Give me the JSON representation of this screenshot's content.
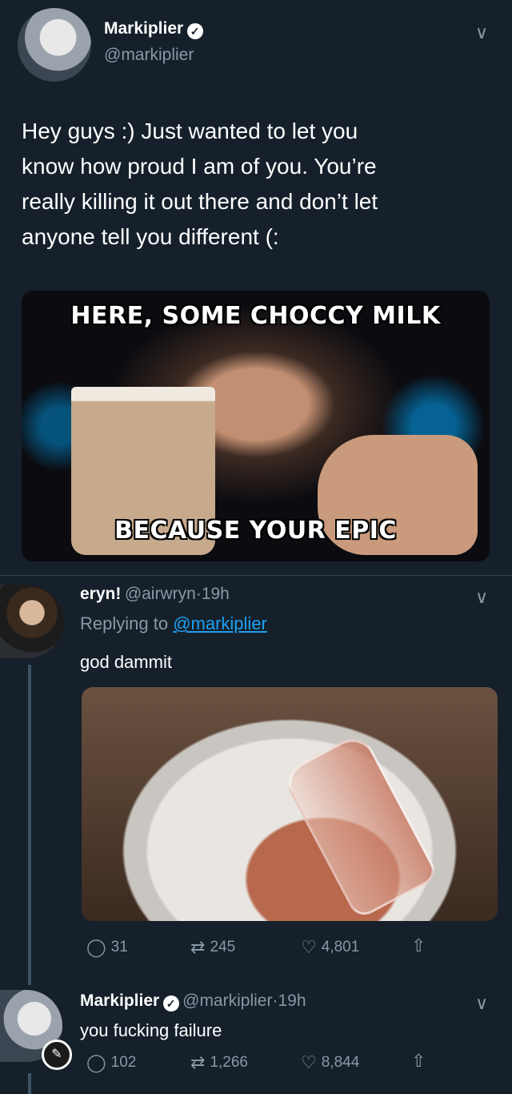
{
  "tweet": {
    "author_name": "Markiplier",
    "author_handle": "@markiplier",
    "text_lines": [
      "Hey guys :) Just wanted to let you",
      "know how proud I am of you. You’re",
      "really killing it out there and don’t let",
      "anyone tell you different (:"
    ],
    "meme_top": "HERE, SOME CHOCCY MILK",
    "meme_bottom": "BECAUSE YOUR EPIC"
  },
  "reply1": {
    "author_name": "eryn!",
    "author_handle": "@airwryn",
    "time": "19h",
    "replying_prefix": "Replying to",
    "replying_to": "@markiplier",
    "text": "god dammit",
    "stats": {
      "replies": "31",
      "retweets": "245",
      "likes": "4,801"
    }
  },
  "reply2": {
    "author_name": "Markiplier",
    "author_handle": "@markiplier",
    "time": "19h",
    "text": "you fucking failure",
    "stats": {
      "replies": "102",
      "retweets": "1,266",
      "likes": "8,844"
    }
  },
  "icons": {
    "reply": "◯",
    "retweet": "⇄",
    "like": "♡",
    "share": "⇧",
    "chevron": "∨",
    "verified": "✓",
    "dot": "·",
    "mic": "✎"
  },
  "colors": {
    "background": "#15202b",
    "muted": "#8899a6",
    "link": "#1da1f2"
  }
}
